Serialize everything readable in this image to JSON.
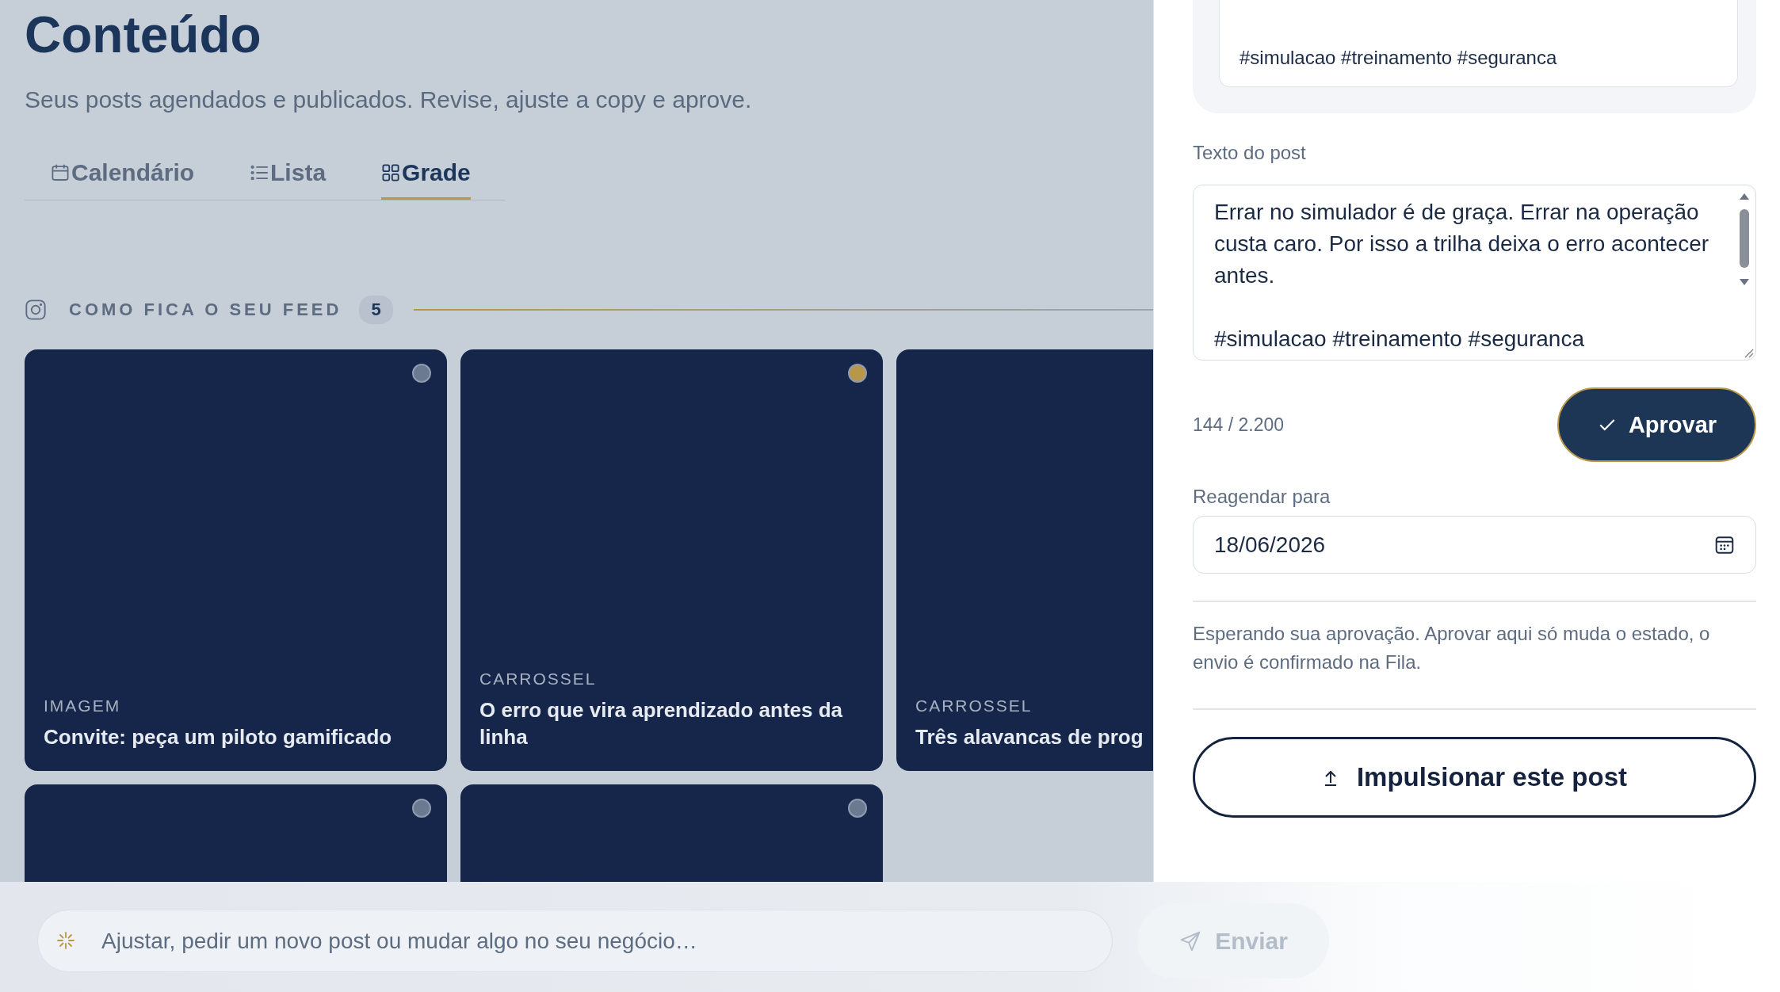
{
  "header": {
    "title": "Conteúdo",
    "subtitle": "Seus posts agendados e publicados. Revise, ajuste a copy e aprove."
  },
  "tabs": [
    {
      "label": "Calendário",
      "selected": false
    },
    {
      "label": "Lista",
      "selected": false
    },
    {
      "label": "Grade",
      "selected": true
    }
  ],
  "feed": {
    "title": "COMO FICA O SEU FEED",
    "count": "5"
  },
  "posts": [
    {
      "format": "IMAGEM",
      "title": "Convite: peça um piloto gamificado",
      "color": "#6b7a90"
    },
    {
      "format": "CARROSSEL",
      "title": "O erro que vira aprendizado antes da linha",
      "color": "#b8974a"
    },
    {
      "format": "CARROSSEL",
      "title": "Três alavancas de prog"
    },
    {
      "color": "#6b7a90"
    },
    {
      "color": "#6b7a90"
    }
  ],
  "editor": {
    "caption_preview": "#simulacao #treinamento #seguranca",
    "text_label": "Texto do post",
    "text": "Errar no simulador é de graça. Errar na operação custa caro. Por isso a trilha deixa o erro acontecer antes.\n\n#simulacao #treinamento #seguranca",
    "counter": "144 / 2.200",
    "approve_button": "Aprovar",
    "reschedule_label": "Reagendar para",
    "date": "18/06/2026",
    "note": "Esperando sua aprovação. Aprovar aqui só muda o estado, o envio é confirmado na Fila.",
    "boost_button": "Impulsionar este post"
  },
  "composer": {
    "placeholder": "Ajustar, pedir um novo post ou mudar algo no seu negócio…",
    "send_button": "Enviar",
    "send_disabled": true
  }
}
